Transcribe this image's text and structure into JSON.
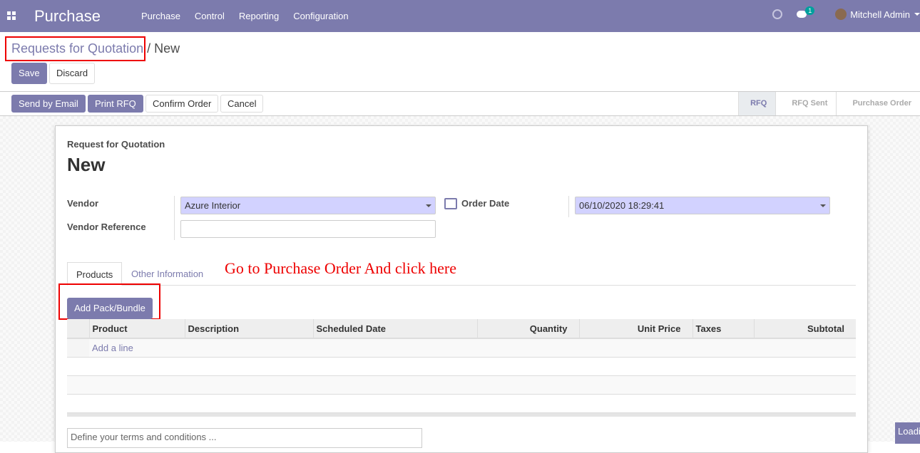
{
  "nav": {
    "app": "Purchase",
    "menu": [
      "Purchase",
      "Control",
      "Reporting",
      "Configuration"
    ],
    "chat_count": "1",
    "user": "Mitchell Admin"
  },
  "breadcrumb": {
    "parent": "Requests for Quotation",
    "sep": "/",
    "current": "New"
  },
  "buttons": {
    "save": "Save",
    "discard": "Discard",
    "send_email": "Send by Email",
    "print": "Print RFQ",
    "confirm": "Confirm Order",
    "cancel": "Cancel"
  },
  "steps": [
    "RFQ",
    "RFQ Sent",
    "Purchase Order"
  ],
  "form": {
    "subtitle": "Request for Quotation",
    "name": "New",
    "vendor_label": "Vendor",
    "vendor": "Azure Interior",
    "vendor_ref_label": "Vendor Reference",
    "vendor_ref": "",
    "order_date_label": "Order Date",
    "order_date": "06/10/2020 18:29:41"
  },
  "tabs": [
    "Products",
    "Other Information"
  ],
  "annotation": "Go to Purchase Order And click here",
  "add_bundle": "Add Pack/Bundle",
  "columns": [
    "Product",
    "Description",
    "Scheduled Date",
    "Quantity",
    "Unit Price",
    "Taxes",
    "Subtotal"
  ],
  "add_line": "Add a line",
  "terms_placeholder": "Define your terms and conditions ...",
  "loading": "Loading"
}
